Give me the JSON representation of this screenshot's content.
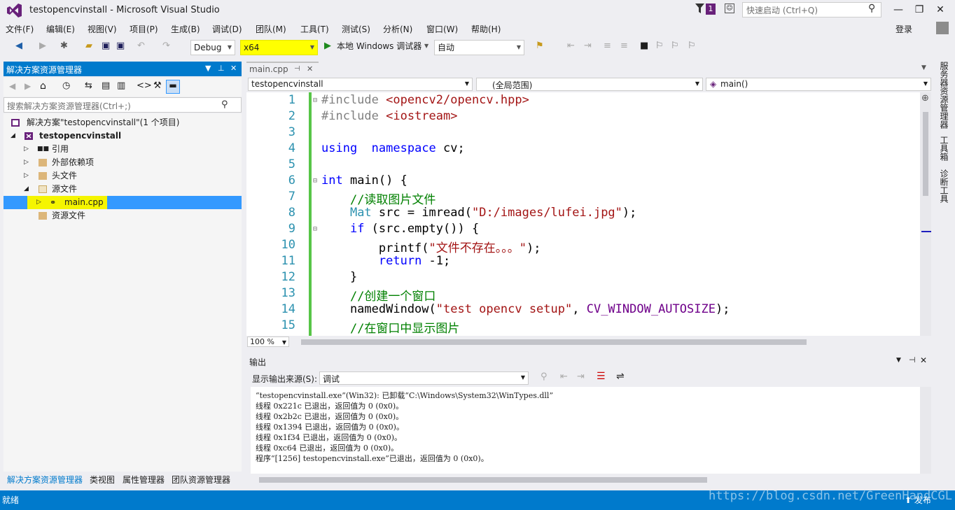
{
  "window": {
    "title": "testopencvinstall - Microsoft Visual Studio",
    "notification_count": "1",
    "quick_launch_placeholder": "快速启动 (Ctrl+Q)"
  },
  "menu": [
    "文件(F)",
    "编辑(E)",
    "视图(V)",
    "项目(P)",
    "生成(B)",
    "调试(D)",
    "团队(M)",
    "工具(T)",
    "测试(S)",
    "分析(N)",
    "窗口(W)",
    "帮助(H)"
  ],
  "login": "登录",
  "toolbar": {
    "config": "Debug",
    "platform": "x64",
    "run_label": "本地 Windows 调试器",
    "run_mode": "自动"
  },
  "solution_explorer": {
    "title": "解决方案资源管理器",
    "search_placeholder": "搜索解决方案资源管理器(Ctrl+;)",
    "tree": [
      {
        "label": "解决方案\"testopencvinstall\"(1 个项目)"
      },
      {
        "label": "testopencvinstall"
      },
      {
        "label": "引用"
      },
      {
        "label": "外部依赖项"
      },
      {
        "label": "头文件"
      },
      {
        "label": "源文件"
      },
      {
        "label": "main.cpp"
      },
      {
        "label": "资源文件"
      }
    ],
    "tabs": [
      "解决方案资源管理器",
      "类视图",
      "属性管理器",
      "团队资源管理器"
    ]
  },
  "editor": {
    "tab": "main.cpp",
    "project_combo": "testopencvinstall",
    "scope_combo": "(全局范围)",
    "member_combo": "main()",
    "zoom": "100 %",
    "line_numbers": [
      "1",
      "2",
      "3",
      "4",
      "5",
      "6",
      "7",
      "8",
      "9",
      "10",
      "11",
      "12",
      "13",
      "14",
      "15"
    ]
  },
  "output": {
    "title": "输出",
    "source_label": "显示输出来源(S):",
    "source_value": "调试",
    "lines": [
      "“testopencvinstall.exe”(Win32): 已卸载“C:\\Windows\\System32\\WinTypes.dll”",
      "线程 0x221c 已退出，返回值为 0 (0x0)。",
      "线程 0x2b2c 已退出，返回值为 0 (0x0)。",
      "线程 0x1394 已退出，返回值为 0 (0x0)。",
      "线程 0x1f34 已退出，返回值为 0 (0x0)。",
      "线程 0xc64 已退出，返回值为 0 (0x0)。",
      "程序“[1256] testopencvinstall.exe”已退出，返回值为 0 (0x0)。"
    ]
  },
  "right_rail": [
    "服务器资源管理器",
    "工具箱",
    "诊断工具"
  ],
  "status": {
    "text": "就绪",
    "publish": "发布",
    "watermark": "https://blog.csdn.net/GreenHandCGL"
  },
  "colors": {
    "accent": "#007acc",
    "highlight": "#ffff00",
    "change_bar": "#57c547",
    "vs_purple": "#68217a"
  }
}
